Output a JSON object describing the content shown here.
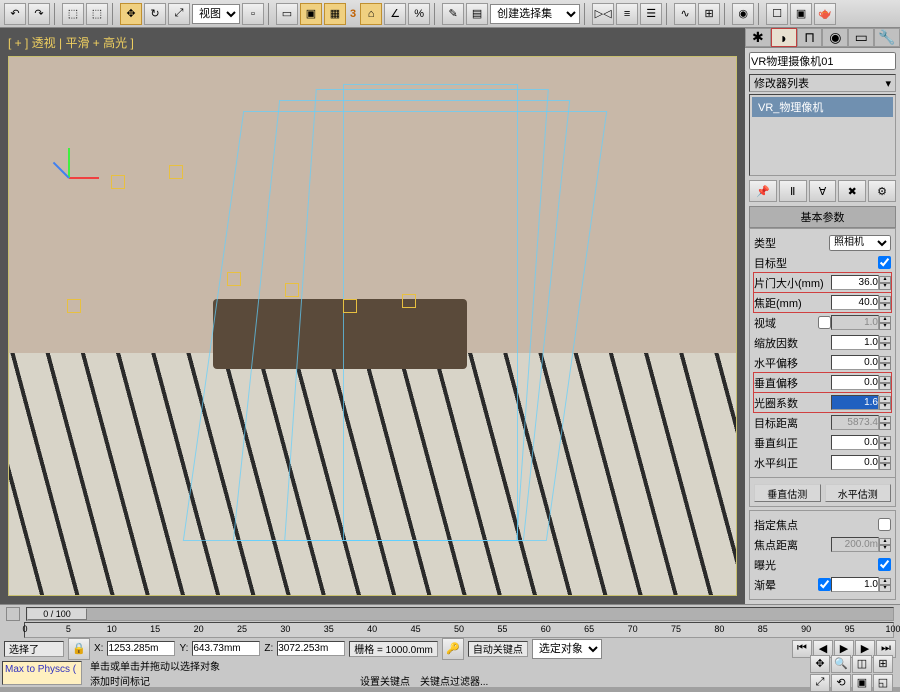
{
  "toolbar": {
    "view_combo": "视图",
    "create_combo": "创建选择集",
    "number_label": "3"
  },
  "viewport": {
    "label": "[ + ] 透视 | 平滑 + 高光 ]"
  },
  "side": {
    "object_name": "VR物理摄像机01",
    "modifier_header": "修改器列表",
    "modifier_item": "VR_物理像机",
    "rollout_title": "基本参数",
    "type_label": "类型",
    "type_value": "照相机",
    "params": [
      {
        "label": "目标型",
        "kind": "check",
        "checked": true,
        "hl": false
      },
      {
        "label": "片门大小(mm)",
        "kind": "num",
        "value": "36.0",
        "hl": true
      },
      {
        "label": "焦距(mm)",
        "kind": "num",
        "value": "40.0",
        "hl": true
      },
      {
        "label": "视域",
        "kind": "numdis",
        "value": "1.0",
        "hl": false,
        "check": false
      },
      {
        "label": "缩放因数",
        "kind": "num",
        "value": "1.0",
        "hl": false
      },
      {
        "label": "水平偏移",
        "kind": "num",
        "value": "0.0",
        "hl": false
      },
      {
        "label": "垂直偏移",
        "kind": "num",
        "value": "0.0",
        "hl": true
      },
      {
        "label": "光圈系数",
        "kind": "numsel",
        "value": "1.6",
        "hl": true
      },
      {
        "label": "目标距离",
        "kind": "numdis",
        "value": "5873.4",
        "hl": false
      },
      {
        "label": "垂直纠正",
        "kind": "num",
        "value": "0.0",
        "hl": false
      },
      {
        "label": "水平纠正",
        "kind": "num",
        "value": "0.0",
        "hl": false
      }
    ],
    "btn_vguess": "垂直估测",
    "btn_hguess": "水平估测",
    "params2": [
      {
        "label": "指定焦点",
        "kind": "check",
        "checked": false
      },
      {
        "label": "焦点距离",
        "kind": "numdis",
        "value": "200.0m"
      },
      {
        "label": "曝光",
        "kind": "check",
        "checked": true
      },
      {
        "label": "渐晕",
        "kind": "numchk",
        "value": "1.0",
        "checked": true
      }
    ]
  },
  "timeline": {
    "slider_label": "0 / 100",
    "ticks": [
      "0",
      "5",
      "10",
      "15",
      "20",
      "25",
      "30",
      "35",
      "40",
      "45",
      "50",
      "55",
      "60",
      "65",
      "70",
      "75",
      "80",
      "85",
      "90",
      "95",
      "100"
    ]
  },
  "status": {
    "selection_hint": "选择了",
    "x_label": "X:",
    "x_val": "1253.285m",
    "y_label": "Y:",
    "y_val": "643.73mm",
    "z_label": "Z:",
    "z_val": "3072.253m",
    "grid": "栅格 = 1000.0mm",
    "autokey": "自动关键点",
    "selobj": "选定对象",
    "setkey": "设置关键点",
    "keyfilter": "关键点过滤器..."
  },
  "bottom": {
    "maxscript": "Max to Physcs (",
    "hint1": "单击或单击并拖动以选择对象",
    "hint2": "添加时间标记"
  }
}
